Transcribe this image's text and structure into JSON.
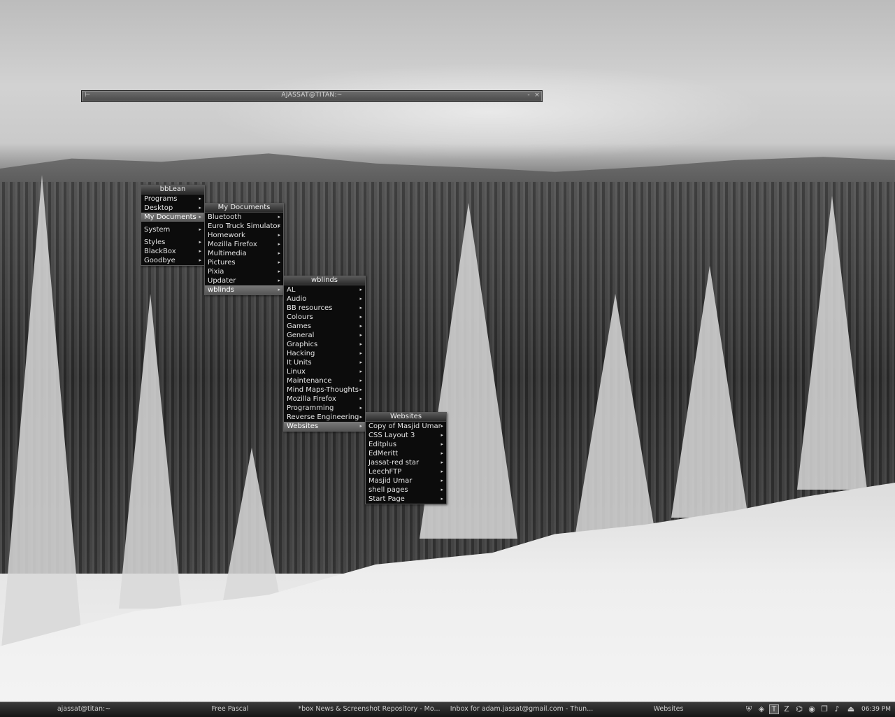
{
  "terminal": {
    "title": "AJASSAT@TITAN:~",
    "btn_left": "⊢",
    "btn_min": "-",
    "btn_close": "×"
  },
  "menus": {
    "bblean": {
      "title": "bbLean",
      "items": [
        {
          "label": "Programs",
          "arrow": "▸"
        },
        {
          "label": "Desktop",
          "arrow": "▸"
        },
        {
          "label": "My Documents",
          "arrow": "▸"
        },
        {
          "label": "System",
          "arrow": "▸"
        },
        {
          "label": "Styles",
          "arrow": "▸"
        },
        {
          "label": "BlackBox",
          "arrow": "▸"
        },
        {
          "label": "Goodbye",
          "arrow": "▸"
        }
      ]
    },
    "documents": {
      "title": "My Documents",
      "items": [
        {
          "label": "Bluetooth",
          "arrow": "▸"
        },
        {
          "label": "Euro Truck Simulator",
          "arrow": "▸"
        },
        {
          "label": "Homework",
          "arrow": "▸"
        },
        {
          "label": "Mozilla Firefox",
          "arrow": "▸"
        },
        {
          "label": "Multimedia",
          "arrow": "▸"
        },
        {
          "label": "Pictures",
          "arrow": "▸"
        },
        {
          "label": "Pixia",
          "arrow": "▸"
        },
        {
          "label": "Updater",
          "arrow": "▸"
        },
        {
          "label": "wblinds",
          "arrow": "▸"
        }
      ]
    },
    "wblinds": {
      "title": "wblinds",
      "items": [
        {
          "label": "AL",
          "arrow": "▸"
        },
        {
          "label": "Audio",
          "arrow": "▸"
        },
        {
          "label": "BB resources",
          "arrow": "▸"
        },
        {
          "label": "Colours",
          "arrow": "▸"
        },
        {
          "label": "Games",
          "arrow": "▸"
        },
        {
          "label": "General",
          "arrow": "▸"
        },
        {
          "label": "Graphics",
          "arrow": "▸"
        },
        {
          "label": "Hacking",
          "arrow": "▸"
        },
        {
          "label": "It Units",
          "arrow": "▸"
        },
        {
          "label": "Linux",
          "arrow": "▸"
        },
        {
          "label": "Maintenance",
          "arrow": "▸"
        },
        {
          "label": "Mind Maps-Thoughts",
          "arrow": "▸"
        },
        {
          "label": "Mozilla Firefox",
          "arrow": "▸"
        },
        {
          "label": "Programming",
          "arrow": "▸"
        },
        {
          "label": "Reverse Engineering",
          "arrow": "▸"
        },
        {
          "label": "Websites",
          "arrow": "▸"
        }
      ]
    },
    "websites": {
      "title": "Websites",
      "items": [
        {
          "label": "Copy of Masjid Umar",
          "arrow": "▸"
        },
        {
          "label": "CSS Layout 3",
          "arrow": "▸"
        },
        {
          "label": "Editplus",
          "arrow": "▸"
        },
        {
          "label": "EdMeritt",
          "arrow": "▸"
        },
        {
          "label": "Jassat-red star",
          "arrow": "▸"
        },
        {
          "label": "LeechFTP",
          "arrow": "▸"
        },
        {
          "label": "Masjid Umar",
          "arrow": "▸"
        },
        {
          "label": "shell pages",
          "arrow": "▸"
        },
        {
          "label": "Start Page",
          "arrow": "▸"
        }
      ]
    }
  },
  "taskbar": {
    "tasks": [
      "ajassat@titan:~",
      "Free Pascal",
      "*box News & Screenshot Repository - Mo...",
      "Inbox for adam.jassat@gmail.com - Thun...",
      "Websites"
    ],
    "tray_icons": [
      {
        "name": "shield-icon",
        "glyph": "⛨"
      },
      {
        "name": "nvidia-icon",
        "glyph": "◈"
      },
      {
        "name": "text-icon",
        "glyph": "T"
      },
      {
        "name": "zip-icon",
        "glyph": "Z"
      },
      {
        "name": "network-icon",
        "glyph": "⌬"
      },
      {
        "name": "record-icon",
        "glyph": "◉"
      },
      {
        "name": "windows-icon",
        "glyph": "❐"
      },
      {
        "name": "speaker-icon",
        "glyph": "♪"
      },
      {
        "name": "eject-icon",
        "glyph": "⏏"
      }
    ],
    "clock": "06:39 PM"
  }
}
